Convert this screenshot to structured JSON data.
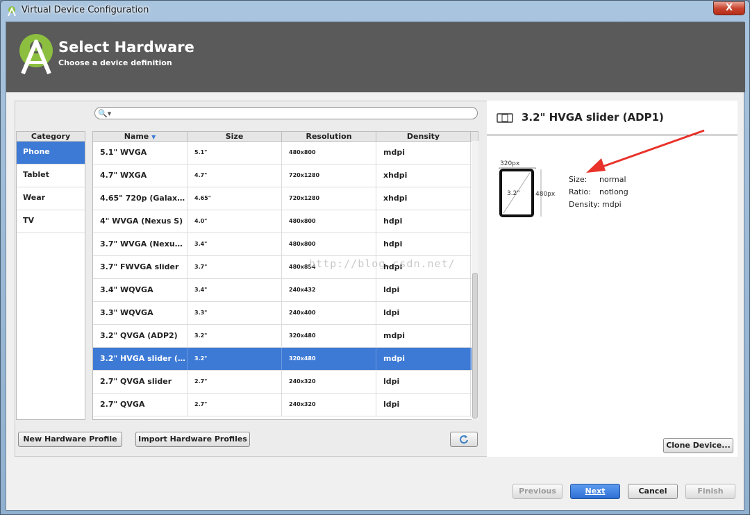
{
  "window": {
    "title": "Virtual Device Configuration",
    "close_label": "X"
  },
  "header": {
    "title": "Select Hardware",
    "subtitle": "Choose a device definition"
  },
  "category": {
    "header": "Category",
    "items": [
      "Phone",
      "Tablet",
      "Wear",
      "TV"
    ],
    "selected": "Phone"
  },
  "table": {
    "columns": [
      "Name",
      "Size",
      "Resolution",
      "Density"
    ],
    "sorted_column": "Name",
    "rows": [
      {
        "name": "5.1\" WVGA",
        "size": "5.1\"",
        "resolution": "480x800",
        "density": "mdpi"
      },
      {
        "name": "4.7\" WXGA",
        "size": "4.7\"",
        "resolution": "720x1280",
        "density": "xhdpi"
      },
      {
        "name": "4.65\" 720p (Galaxy ...",
        "size": "4.65\"",
        "resolution": "720x1280",
        "density": "xhdpi"
      },
      {
        "name": "4\" WVGA (Nexus S)",
        "size": "4.0\"",
        "resolution": "480x800",
        "density": "hdpi"
      },
      {
        "name": "3.7\" WVGA (Nexus ...",
        "size": "3.4\"",
        "resolution": "480x800",
        "density": "hdpi"
      },
      {
        "name": "3.7\" FWVGA slider",
        "size": "3.7\"",
        "resolution": "480x854",
        "density": "hdpi"
      },
      {
        "name": "3.4\" WQVGA",
        "size": "3.4\"",
        "resolution": "240x432",
        "density": "ldpi"
      },
      {
        "name": "3.3\" WQVGA",
        "size": "3.3\"",
        "resolution": "240x400",
        "density": "ldpi"
      },
      {
        "name": "3.2\" QVGA (ADP2)",
        "size": "3.2\"",
        "resolution": "320x480",
        "density": "mdpi"
      },
      {
        "name": "3.2\" HVGA slider (A...",
        "size": "3.2\"",
        "resolution": "320x480",
        "density": "mdpi"
      },
      {
        "name": "2.7\" QVGA slider",
        "size": "2.7\"",
        "resolution": "240x320",
        "density": "ldpi"
      },
      {
        "name": "2.7\" QVGA",
        "size": "2.7\"",
        "resolution": "240x320",
        "density": "ldpi"
      }
    ],
    "selected_index": 9
  },
  "buttons": {
    "new_profile": "New Hardware Profile",
    "import_profiles": "Import Hardware Profiles",
    "clone_device": "Clone Device...",
    "previous": "Previous",
    "next": "Next",
    "cancel": "Cancel",
    "finish": "Finish"
  },
  "details": {
    "title": "3.2\" HVGA slider (ADP1)",
    "width_px": "320px",
    "height_px": "480px",
    "diagonal": "3.2\"",
    "size_label": "Size:",
    "size_value": "normal",
    "ratio_label": "Ratio:",
    "ratio_value": "notlong",
    "density_label": "Density:",
    "density_value": "mdpi"
  },
  "watermark": "http://blog.csdn.net/",
  "colors": {
    "selection": "#3d7ad6",
    "header_bg": "#5a5a5a",
    "android_green": "#8cbf3f",
    "arrow_red": "#e8322a"
  },
  "icons": {
    "logo": "android-studio-logo",
    "search": "search-icon",
    "refresh": "refresh-icon",
    "device": "device-icon"
  }
}
